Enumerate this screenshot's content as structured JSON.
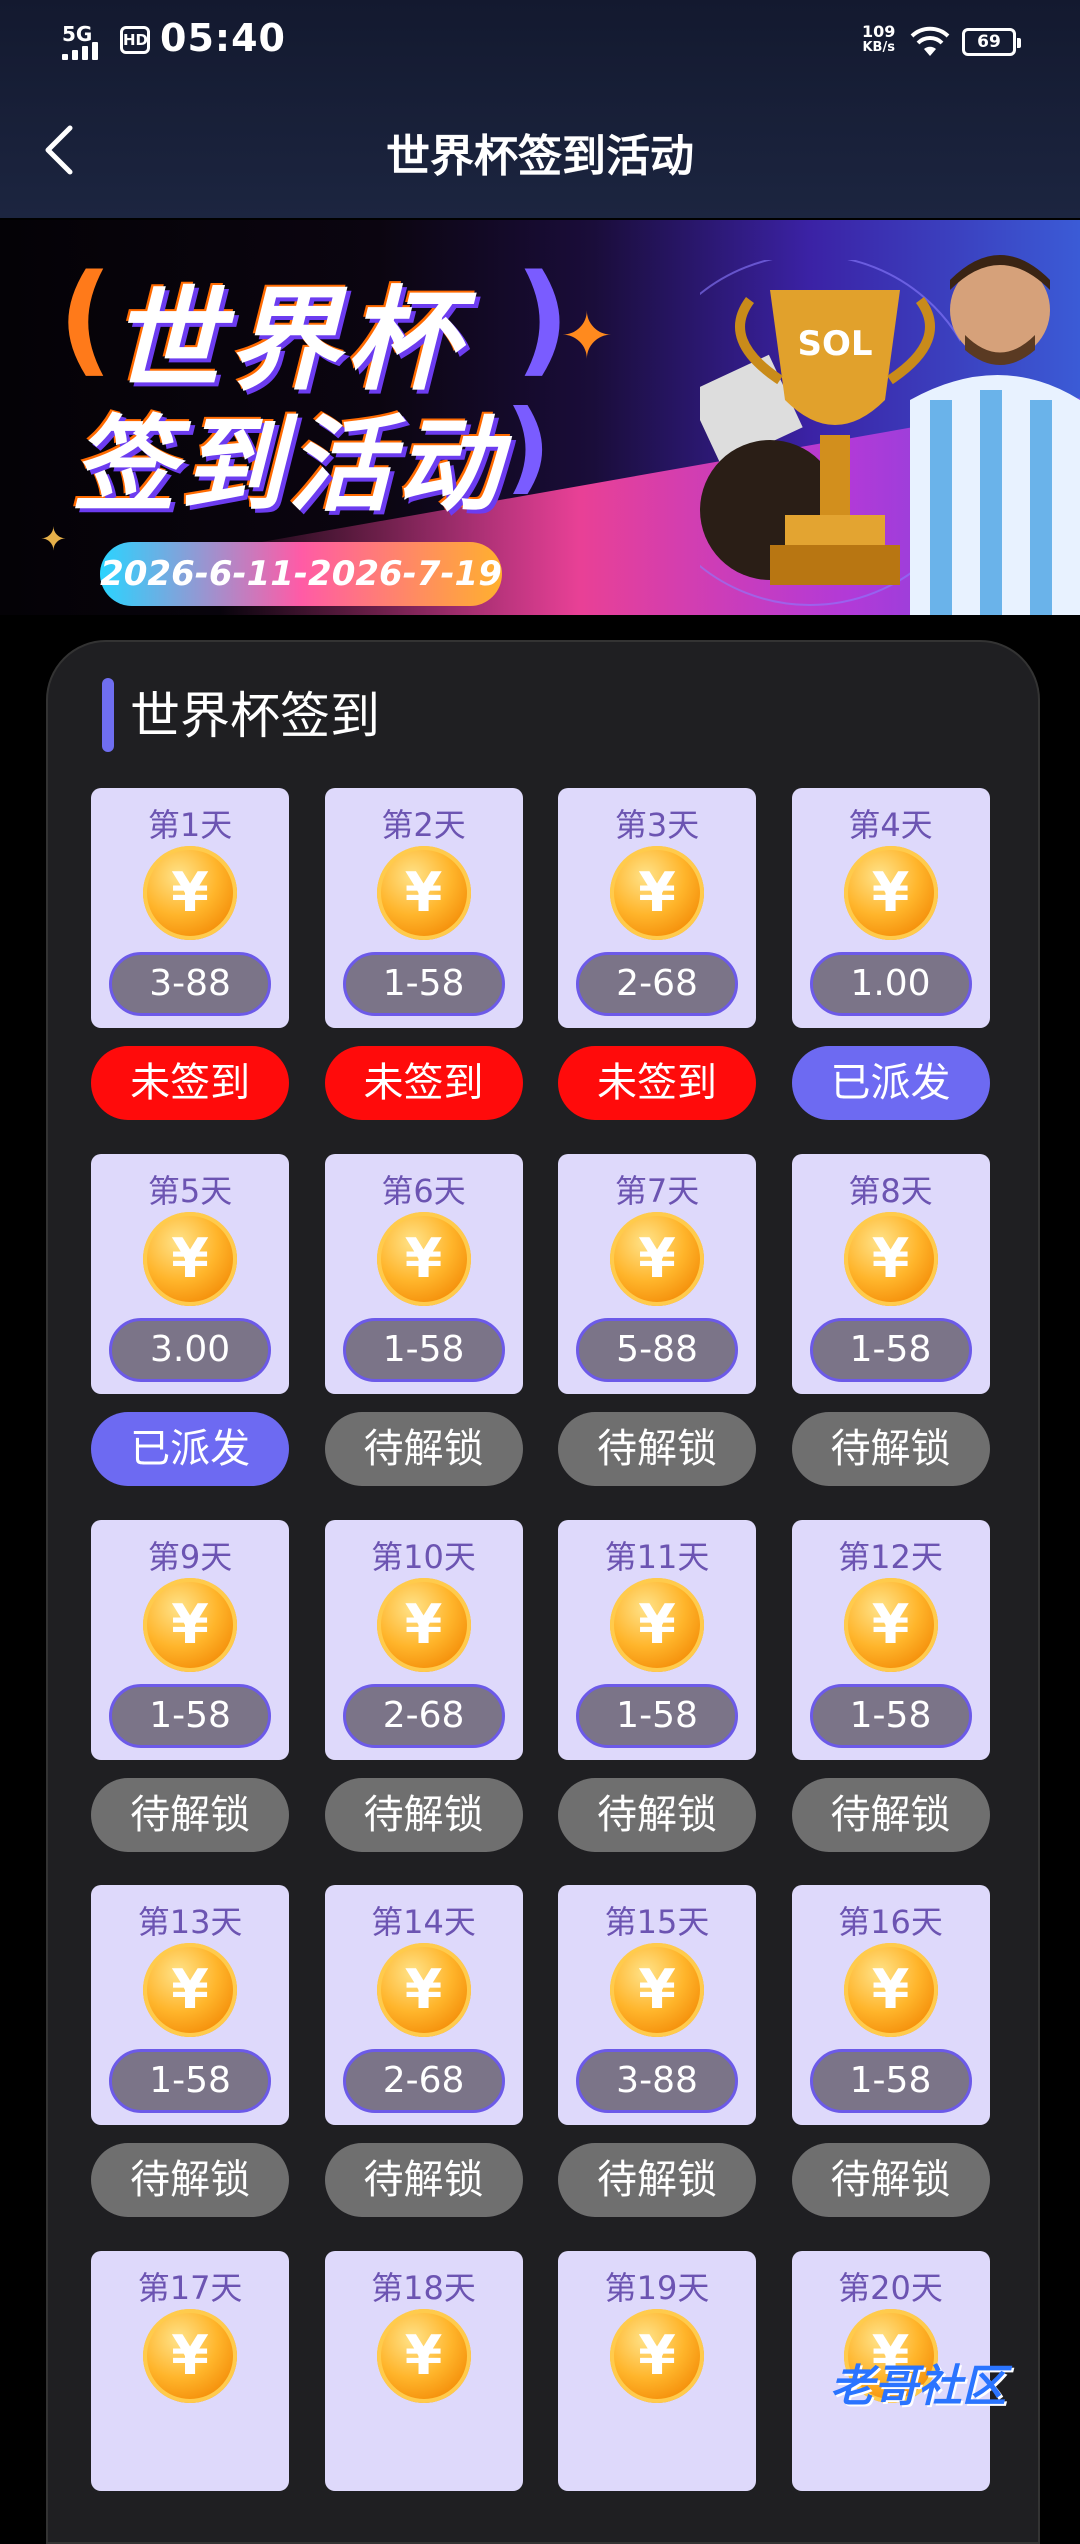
{
  "status_bar": {
    "signal": "5G",
    "hd": "HD",
    "time": "05:40",
    "net_speed": "109",
    "net_unit": "KB/s",
    "battery": "69"
  },
  "header": {
    "title": "世界杯签到活动"
  },
  "banner": {
    "line1": "世界杯",
    "line2": "签到活动",
    "date_range": "2026-6-11-2026-7-19",
    "trophy_text": "SOL"
  },
  "section": {
    "title": "世界杯签到"
  },
  "days": [
    {
      "label": "第1天",
      "amount": "3-88",
      "status": "未签到",
      "state": "red"
    },
    {
      "label": "第2天",
      "amount": "1-58",
      "status": "未签到",
      "state": "red"
    },
    {
      "label": "第3天",
      "amount": "2-68",
      "status": "未签到",
      "state": "red"
    },
    {
      "label": "第4天",
      "amount": "1.00",
      "status": "已派发",
      "state": "blue"
    },
    {
      "label": "第5天",
      "amount": "3.00",
      "status": "已派发",
      "state": "blue"
    },
    {
      "label": "第6天",
      "amount": "1-58",
      "status": "待解锁",
      "state": "gray"
    },
    {
      "label": "第7天",
      "amount": "5-88",
      "status": "待解锁",
      "state": "gray"
    },
    {
      "label": "第8天",
      "amount": "1-58",
      "status": "待解锁",
      "state": "gray"
    },
    {
      "label": "第9天",
      "amount": "1-58",
      "status": "待解锁",
      "state": "gray"
    },
    {
      "label": "第10天",
      "amount": "2-68",
      "status": "待解锁",
      "state": "gray"
    },
    {
      "label": "第11天",
      "amount": "1-58",
      "status": "待解锁",
      "state": "gray"
    },
    {
      "label": "第12天",
      "amount": "1-58",
      "status": "待解锁",
      "state": "gray"
    },
    {
      "label": "第13天",
      "amount": "1-58",
      "status": "待解锁",
      "state": "gray"
    },
    {
      "label": "第14天",
      "amount": "2-68",
      "status": "待解锁",
      "state": "gray"
    },
    {
      "label": "第15天",
      "amount": "3-88",
      "status": "待解锁",
      "state": "gray"
    },
    {
      "label": "第16天",
      "amount": "1-58",
      "status": "待解锁",
      "state": "gray"
    },
    {
      "label": "第17天",
      "amount": "",
      "status": "",
      "state": "gray"
    },
    {
      "label": "第18天",
      "amount": "",
      "status": "",
      "state": "gray"
    },
    {
      "label": "第19天",
      "amount": "",
      "status": "",
      "state": "gray"
    },
    {
      "label": "第20天",
      "amount": "",
      "status": "",
      "state": "gray"
    }
  ],
  "coin_symbol": "¥",
  "watermark": "老哥社区",
  "colors": {
    "accent": "#6d6af2",
    "unsigned": "#ff0b0b",
    "locked": "#6f6f6f",
    "tile": "#ded9fb"
  }
}
